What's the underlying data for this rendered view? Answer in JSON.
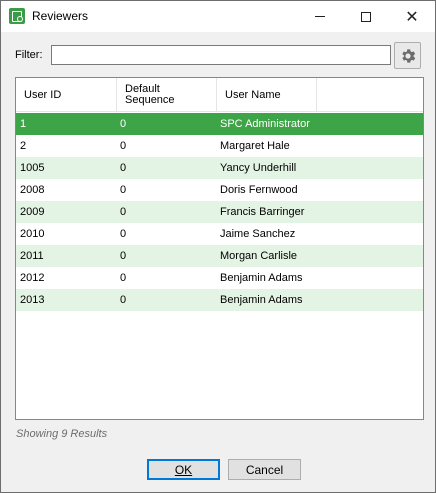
{
  "window": {
    "title": "Reviewers"
  },
  "filter": {
    "label": "Filter:",
    "value": "",
    "placeholder": ""
  },
  "grid": {
    "columns": [
      {
        "key": "user_id",
        "label": "User ID"
      },
      {
        "key": "default_sequence",
        "label": "Default\nSequence"
      },
      {
        "key": "user_name",
        "label": "User Name"
      }
    ],
    "rows": [
      {
        "user_id": "1",
        "default_sequence": "0",
        "user_name": "SPC Administrator",
        "selected": true
      },
      {
        "user_id": "2",
        "default_sequence": "0",
        "user_name": "Margaret Hale"
      },
      {
        "user_id": "1005",
        "default_sequence": "0",
        "user_name": "Yancy Underhill"
      },
      {
        "user_id": "2008",
        "default_sequence": "0",
        "user_name": "Doris Fernwood"
      },
      {
        "user_id": "2009",
        "default_sequence": "0",
        "user_name": "Francis Barringer"
      },
      {
        "user_id": "2010",
        "default_sequence": "0",
        "user_name": "Jaime Sanchez"
      },
      {
        "user_id": "2011",
        "default_sequence": "0",
        "user_name": "Morgan Carlisle"
      },
      {
        "user_id": "2012",
        "default_sequence": "0",
        "user_name": "Benjamin Adams"
      },
      {
        "user_id": "2013",
        "default_sequence": "0",
        "user_name": "Benjamin Adams"
      }
    ]
  },
  "status": {
    "text": "Showing 9 Results"
  },
  "buttons": {
    "ok_label": "OK",
    "cancel_label": "Cancel"
  },
  "colors": {
    "selected_row": "#3ea448",
    "alt_row": "#e4f4e4",
    "app_icon": "#3a9c47"
  },
  "icons": {
    "app": "reviewers-app-icon",
    "settings": "gear-icon"
  }
}
